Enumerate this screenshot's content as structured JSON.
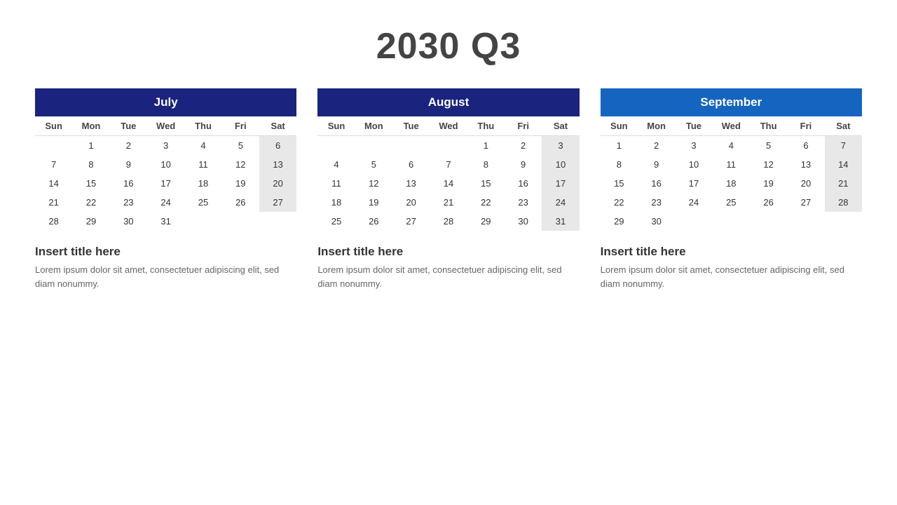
{
  "title": "2030 Q3",
  "calendars": [
    {
      "id": "july",
      "month": "July",
      "headerClass": "july-header",
      "days_of_week": [
        "Sun",
        "Mon",
        "Tue",
        "Wed",
        "Thu",
        "Fri",
        "Sat"
      ],
      "weeks": [
        [
          null,
          1,
          2,
          3,
          4,
          5,
          6
        ],
        [
          7,
          8,
          9,
          10,
          11,
          12,
          13
        ],
        [
          14,
          15,
          16,
          17,
          18,
          19,
          20
        ],
        [
          21,
          22,
          23,
          24,
          25,
          26,
          27
        ],
        [
          28,
          29,
          30,
          31,
          null,
          null,
          null
        ]
      ],
      "info_title": "Insert title here",
      "info_text": "Lorem ipsum dolor sit amet, consectetuer adipiscing elit, sed diam nonummy."
    },
    {
      "id": "august",
      "month": "August",
      "headerClass": "august-header",
      "days_of_week": [
        "Sun",
        "Mon",
        "Tue",
        "Wed",
        "Thu",
        "Fri",
        "Sat"
      ],
      "weeks": [
        [
          null,
          null,
          null,
          null,
          1,
          2,
          3
        ],
        [
          4,
          5,
          6,
          7,
          8,
          9,
          10
        ],
        [
          11,
          12,
          13,
          14,
          15,
          16,
          17
        ],
        [
          18,
          19,
          20,
          21,
          22,
          23,
          24
        ],
        [
          25,
          26,
          27,
          28,
          29,
          30,
          31
        ]
      ],
      "info_title": "Insert title here",
      "info_text": "Lorem ipsum dolor sit amet, consectetuer adipiscing elit, sed diam nonummy."
    },
    {
      "id": "september",
      "month": "September",
      "headerClass": "september-header",
      "days_of_week": [
        "Sun",
        "Mon",
        "Tue",
        "Wed",
        "Thu",
        "Fri",
        "Sat"
      ],
      "weeks": [
        [
          1,
          2,
          3,
          4,
          5,
          6,
          7
        ],
        [
          8,
          9,
          10,
          11,
          12,
          13,
          14
        ],
        [
          15,
          16,
          17,
          18,
          19,
          20,
          21
        ],
        [
          22,
          23,
          24,
          25,
          26,
          27,
          28
        ],
        [
          29,
          30,
          null,
          null,
          null,
          null,
          null
        ]
      ],
      "info_title": "Insert title here",
      "info_text": "Lorem ipsum dolor sit amet, consectetuer adipiscing elit, sed diam nonummy."
    }
  ]
}
